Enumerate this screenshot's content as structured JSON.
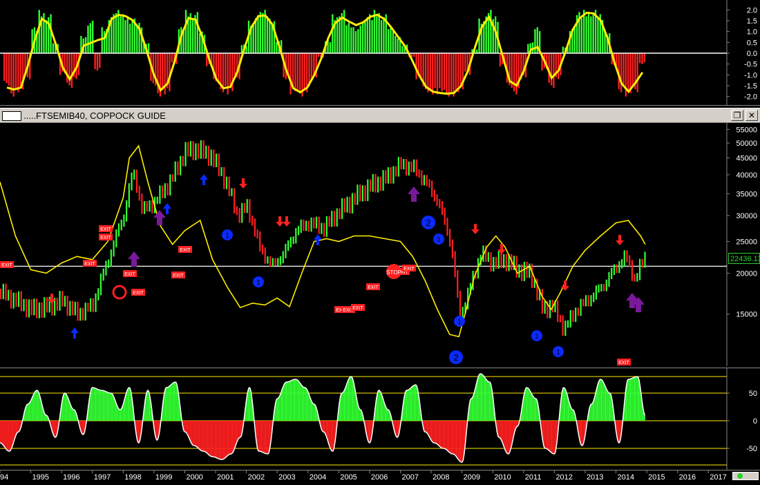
{
  "window": {
    "title": ".....FTSEMIB40, COPPOCK GUIDE",
    "last_price": "22436.13",
    "buttons": [
      "❐",
      "✕"
    ]
  },
  "top_panel": {
    "y_labels": [
      "2.0",
      "1.5",
      "1.0",
      "0.5",
      "0.0",
      "-0.5",
      "-1.0",
      "-1.5",
      "-2.0"
    ],
    "colors": {
      "positive": "#33ff33",
      "negative": "#ff2020",
      "neutral": "#888888",
      "line": "#ffee00"
    }
  },
  "main_panel": {
    "y_labels": [
      "55000",
      "50000",
      "45000",
      "40000",
      "35000",
      "30000",
      "25000",
      "20000",
      "15000"
    ],
    "colors": {
      "up": "#33ff33",
      "down": "#ff2020",
      "guide": "#ffee00",
      "marker_blue": "#0a2aff",
      "marker_purple": "#7a1a9a"
    },
    "signal_labels": {
      "exit": "EXIT",
      "stop": "STOP",
      "one": "1",
      "two": "2"
    }
  },
  "bottom_panel": {
    "y_labels": [
      "50",
      "0",
      "-50"
    ],
    "colors": {
      "positive": "#33ff33",
      "negative": "#ff2020",
      "line": "#ffffff",
      "levels": "#ffee00"
    }
  },
  "x_axis": {
    "years": [
      "94",
      "1995",
      "1996",
      "1997",
      "1998",
      "1999",
      "2000",
      "2001",
      "2002",
      "2003",
      "2004",
      "2005",
      "2006",
      "2007",
      "2008",
      "2009",
      "2010",
      "2011",
      "2012",
      "2013",
      "2014",
      "2015",
      "2016",
      "2017"
    ]
  },
  "chart_data": [
    {
      "type": "bar",
      "title": "",
      "ylim": [
        -2.2,
        2.2
      ],
      "series": [
        {
          "name": "",
          "values": [
            -1.5,
            -2,
            -1.8,
            -1.2,
            1.2,
            2,
            1.8,
            0.5,
            -1,
            -1.6,
            -1.2,
            0.8,
            1.5,
            -0.8,
            1.2,
            1.8,
            2,
            1.8,
            1.6,
            1.4,
            0.5,
            -1.5,
            -2,
            -1.9,
            -0.5,
            1.2,
            2,
            1.9,
            1,
            -0.6,
            -1.4,
            -1.8,
            -1.9,
            -1.2,
            0.4,
            1.5,
            1.9,
            2,
            1.6,
            0.6,
            -1.2,
            -1.9,
            -2,
            -1.8,
            -1.2,
            -0.2,
            0.6,
            1.8,
            2,
            1.4,
            1.2,
            1.5,
            1.8,
            2,
            1.8,
            1.2,
            0.8,
            0.4,
            -0.2,
            -1.2,
            -1.8,
            -1.9,
            -1.9,
            -2,
            -2,
            -1.8,
            -1.0,
            0.2,
            1.6,
            2,
            1.7,
            -0.6,
            -1.6,
            -1.9,
            -1.2,
            0.5,
            1.2,
            -0.8,
            -1.6,
            -1.2,
            0.3,
            1.2,
            1.9,
            2,
            2,
            1.8,
            1.0,
            -0.6,
            -1.8,
            -2,
            -1.8,
            -0.5
          ]
        }
      ]
    },
    {
      "type": "line",
      "title": "FTSEMIB40, COPPOCK GUIDE",
      "xlabel": "",
      "ylabel": "",
      "log_scale": true,
      "ylim": [
        10500,
        57000
      ],
      "x_range": [
        1994.0,
        2017.6
      ],
      "series": [
        {
          "name": "",
          "x": [
            1994.0,
            1994.5,
            1995.0,
            1995.5,
            1996.0,
            1996.5,
            1997.0,
            1997.5,
            1998.0,
            1998.3,
            1998.6,
            1999.0,
            1999.5,
            2000.0,
            2000.3,
            2000.8,
            2001.2,
            2001.7,
            2002.0,
            2002.4,
            2002.8,
            2003.2,
            2003.6,
            2004.0,
            2004.5,
            2005.0,
            2005.5,
            2006.0,
            2006.5,
            2007.0,
            2007.4,
            2007.8,
            2008.2,
            2008.6,
            2008.9,
            2009.2,
            2009.6,
            2010.0,
            2010.4,
            2010.8,
            2011.2,
            2011.6,
            2011.9,
            2012.3,
            2012.7,
            2013.2,
            2013.6,
            2014.0,
            2014.3,
            2014.6,
            2014.9
          ],
          "values": [
            17500,
            16500,
            15500,
            15800,
            16500,
            15000,
            16000,
            22000,
            30000,
            41000,
            31000,
            33000,
            38000,
            47000,
            48000,
            46000,
            40000,
            30000,
            32000,
            24000,
            21000,
            23000,
            27000,
            28500,
            27500,
            31000,
            34000,
            37000,
            39000,
            43000,
            42000,
            38000,
            33000,
            25000,
            14500,
            17500,
            23000,
            21500,
            22000,
            20500,
            20000,
            15500,
            16000,
            13500,
            15500,
            17000,
            18500,
            21000,
            22500,
            19000,
            22436
          ]
        },
        {
          "name": "",
          "x": [
            1994.0,
            1994.5,
            1995.0,
            1995.5,
            1996.0,
            1996.5,
            1997.0,
            1997.5,
            1998.0,
            1998.2,
            1998.5,
            1998.8,
            1999.2,
            1999.6,
            2000.0,
            2000.5,
            2000.9,
            2001.4,
            2001.8,
            2002.2,
            2002.6,
            2003.0,
            2003.4,
            2003.8,
            2004.2,
            2004.6,
            2005.0,
            2005.5,
            2006.0,
            2006.5,
            2007.0,
            2007.4,
            2007.8,
            2008.2,
            2008.6,
            2008.9,
            2009.1,
            2009.4,
            2009.8,
            2010.1,
            2010.4,
            2010.8,
            2011.2,
            2011.6,
            2011.9,
            2012.2,
            2012.6,
            2013.0,
            2013.5,
            2014.0,
            2014.4,
            2014.8,
            2014.95
          ],
          "values": [
            38000,
            26000,
            20500,
            20000,
            21500,
            22500,
            22000,
            25000,
            34000,
            45000,
            49000,
            38000,
            28000,
            24500,
            27000,
            29000,
            22000,
            18000,
            15700,
            16200,
            16000,
            16800,
            15800,
            20000,
            25000,
            25500,
            25000,
            26000,
            26000,
            25500,
            25000,
            22500,
            19000,
            15500,
            13000,
            12800,
            15000,
            19500,
            24000,
            26000,
            24000,
            20000,
            21000,
            17000,
            15500,
            17500,
            21000,
            23500,
            26000,
            28500,
            29000,
            26000,
            24500
          ]
        }
      ],
      "reference_line": 21000
    },
    {
      "type": "bar",
      "title": "",
      "ylim": [
        -85,
        90
      ],
      "levels": [
        80,
        50,
        0,
        -50,
        -80
      ],
      "series": [
        {
          "name": "",
          "x": [
            1994.0,
            1994.3,
            1994.6,
            1994.9,
            1995.2,
            1995.5,
            1995.8,
            1996.1,
            1996.4,
            1996.7,
            1997.0,
            1997.3,
            1997.6,
            1997.9,
            1998.2,
            1998.5,
            1998.8,
            1999.1,
            1999.4,
            1999.7,
            2000.0,
            2000.3,
            2000.6,
            2000.9,
            2001.2,
            2001.5,
            2001.8,
            2002.1,
            2002.4,
            2002.7,
            2003.0,
            2003.3,
            2003.6,
            2003.9,
            2004.2,
            2004.5,
            2004.8,
            2005.1,
            2005.4,
            2005.7,
            2006.0,
            2006.3,
            2006.6,
            2006.9,
            2007.2,
            2007.5,
            2007.8,
            2008.1,
            2008.4,
            2008.7,
            2009.0,
            2009.3,
            2009.6,
            2009.9,
            2010.2,
            2010.5,
            2010.8,
            2011.1,
            2011.4,
            2011.7,
            2012.0,
            2012.3,
            2012.6,
            2012.9,
            2013.2,
            2013.5,
            2013.8,
            2014.1,
            2014.4,
            2014.7,
            2014.95
          ],
          "values": [
            -40,
            -55,
            -20,
            30,
            55,
            10,
            -30,
            50,
            20,
            -25,
            60,
            55,
            50,
            20,
            60,
            -40,
            55,
            -35,
            60,
            70,
            -20,
            -45,
            -55,
            -65,
            -70,
            -60,
            -30,
            60,
            -55,
            -60,
            40,
            70,
            75,
            60,
            30,
            -20,
            -55,
            50,
            80,
            20,
            -40,
            55,
            20,
            -30,
            55,
            65,
            -20,
            -40,
            -50,
            -60,
            -75,
            40,
            85,
            70,
            -30,
            -60,
            -10,
            60,
            40,
            -50,
            -60,
            60,
            20,
            -45,
            30,
            75,
            50,
            -40,
            75,
            80,
            10
          ]
        }
      ]
    }
  ]
}
